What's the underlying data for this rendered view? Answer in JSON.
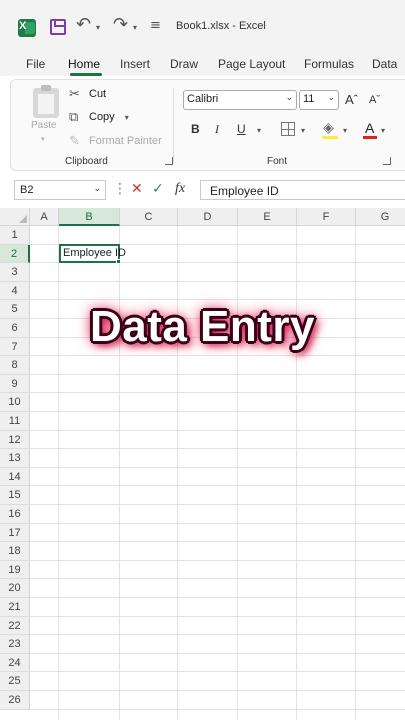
{
  "titlebar": {
    "app_letter": "X",
    "undo_glyph": "↶",
    "redo_glyph": "↷",
    "more_glyph": "≡",
    "doc_title": "Book1.xlsx  -  Excel"
  },
  "tabs": [
    {
      "label": "File"
    },
    {
      "label": "Home",
      "active": true
    },
    {
      "label": "Insert"
    },
    {
      "label": "Draw"
    },
    {
      "label": "Page Layout"
    },
    {
      "label": "Formulas"
    },
    {
      "label": "Data"
    }
  ],
  "clipboard": {
    "paste_label": "Paste",
    "cut_label": "Cut",
    "copy_label": "Copy",
    "format_painter_label": "Format Painter",
    "group_label": "Clipboard"
  },
  "font": {
    "font_name": "Calibri",
    "font_size": "11",
    "grow_label": "Aˆ",
    "shrink_label": "Aˇ",
    "bold_label": "B",
    "italic_label": "I",
    "underline_label": "U",
    "font_color_label": "A",
    "group_label": "Font",
    "fill_color": "#ffeb3b",
    "font_color": "#e02020"
  },
  "formula_bar": {
    "name_box": "B2",
    "cancel_glyph": "✕",
    "enter_glyph": "✓",
    "fx_label": "fx",
    "value": "Employee ID"
  },
  "grid": {
    "columns": [
      "A",
      "B",
      "C",
      "D",
      "E",
      "F",
      "G"
    ],
    "selected_column": "B",
    "rows": [
      "1",
      "2",
      "3",
      "4",
      "5",
      "6",
      "7",
      "8",
      "9",
      "10",
      "11",
      "12",
      "13",
      "14",
      "15",
      "16",
      "17",
      "18",
      "19",
      "20",
      "21",
      "22",
      "23",
      "24",
      "25",
      "26"
    ],
    "selected_row": "2",
    "active_cell_value": "Employee ID"
  },
  "overlay": {
    "title": "Data Entry"
  },
  "colors": {
    "accent": "#1e7145",
    "overlay_glow": "#e01a55"
  }
}
